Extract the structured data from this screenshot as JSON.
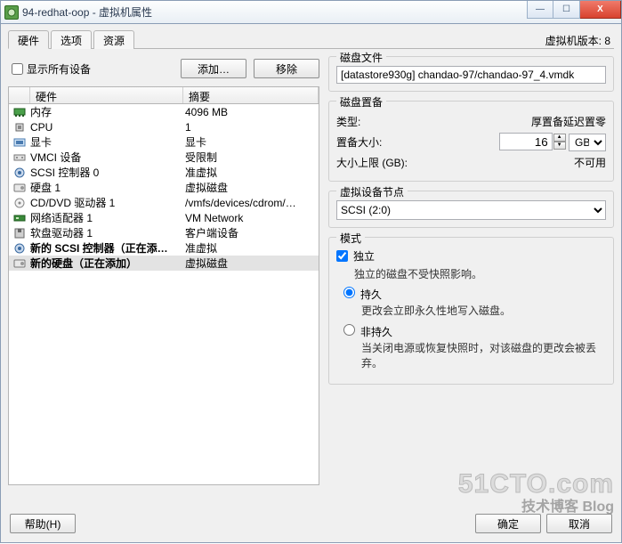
{
  "window": {
    "title": "94-redhat-oop - 虚拟机属性",
    "min": "—",
    "max": "☐",
    "close": "X"
  },
  "tabs": [
    "硬件",
    "选项",
    "资源"
  ],
  "vm_version_label": "虚拟机版本: 8",
  "show_all_devices": "显示所有设备",
  "buttons": {
    "add": "添加…",
    "remove": "移除",
    "help": "帮助(H)",
    "ok": "确定",
    "cancel": "取消"
  },
  "columns": {
    "hw": "硬件",
    "summary": "摘要"
  },
  "rows": [
    {
      "icon": "mem",
      "hw": "内存",
      "sm": "4096 MB"
    },
    {
      "icon": "cpu",
      "hw": "CPU",
      "sm": "1"
    },
    {
      "icon": "vid",
      "hw": "显卡",
      "sm": "显卡"
    },
    {
      "icon": "vmci",
      "hw": "VMCI 设备",
      "sm": "受限制"
    },
    {
      "icon": "scsi",
      "hw": "SCSI 控制器 0",
      "sm": "准虚拟"
    },
    {
      "icon": "disk",
      "hw": "硬盘 1",
      "sm": "虚拟磁盘"
    },
    {
      "icon": "cd",
      "hw": "CD/DVD 驱动器 1",
      "sm": "/vmfs/devices/cdrom/…"
    },
    {
      "icon": "nic",
      "hw": "网络适配器 1",
      "sm": "VM Network"
    },
    {
      "icon": "flop",
      "hw": "软盘驱动器 1",
      "sm": "客户端设备"
    },
    {
      "icon": "scsi",
      "hw": "新的 SCSI 控制器（正在添…",
      "sm": "准虚拟",
      "bold": true
    },
    {
      "icon": "disk",
      "hw": "新的硬盘（正在添加）",
      "sm": "虚拟磁盘",
      "bold": true,
      "sel": true
    }
  ],
  "disk_file": {
    "title": "磁盘文件",
    "value": "[datastore930g] chandao-97/chandao-97_4.vmdk"
  },
  "disk_prov": {
    "title": "磁盘置备",
    "type_label": "类型:",
    "type_value": "厚置备延迟置零",
    "size_label": "置备大小:",
    "size_value": "16",
    "size_unit": "GB",
    "max_label": "大小上限 (GB):",
    "max_value": "不可用"
  },
  "vnode": {
    "title": "虚拟设备节点",
    "value": "SCSI (2:0)"
  },
  "mode": {
    "title": "模式",
    "independent": "独立",
    "independent_desc": "独立的磁盘不受快照影响。",
    "persistent": "持久",
    "persistent_desc": "更改会立即永久性地写入磁盘。",
    "nonpersistent": "非持久",
    "nonpersistent_desc": "当关闭电源或恢复快照时，对该磁盘的更改会被丢弃。"
  },
  "watermark": {
    "big": "51CTO.com",
    "sub": "技术博客 Blog"
  }
}
